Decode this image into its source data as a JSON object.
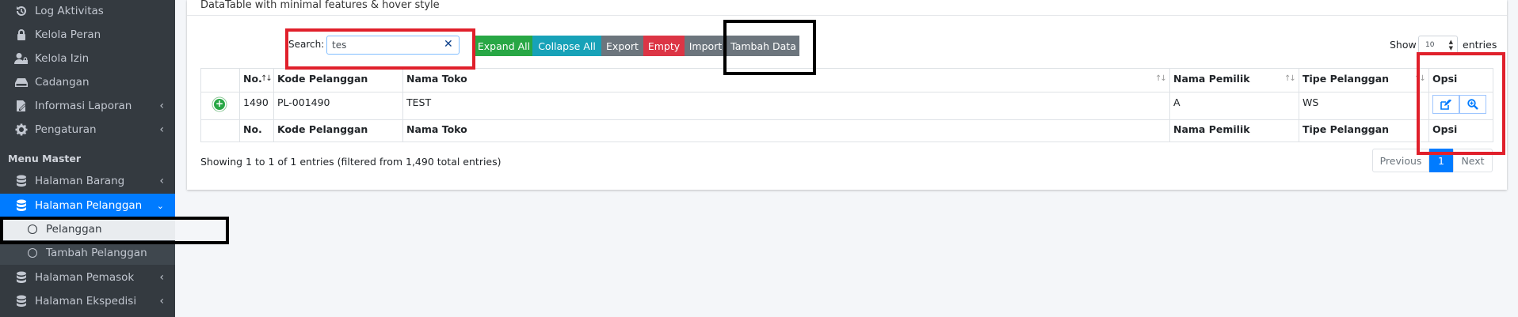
{
  "sidebar": {
    "items": [
      {
        "label": "Log Aktivitas",
        "icon": "history-icon"
      },
      {
        "label": "Kelola Peran",
        "icon": "lock-icon"
      },
      {
        "label": "Kelola Izin",
        "icon": "user-lock-icon"
      },
      {
        "label": "Cadangan",
        "icon": "hdd-icon"
      },
      {
        "label": "Informasi Laporan",
        "icon": "report-icon"
      },
      {
        "label": "Pengaturan",
        "icon": "gear-icon"
      }
    ],
    "header": "Menu Master",
    "master": [
      {
        "label": "Halaman Barang",
        "icon": "database-icon"
      },
      {
        "label": "Halaman Pelanggan",
        "icon": "database-icon"
      },
      {
        "label": "Pelanggan",
        "icon": "circle-icon"
      },
      {
        "label": "Tambah Pelanggan",
        "icon": "circle-icon"
      },
      {
        "label": "Halaman Pemasok",
        "icon": "database-icon"
      },
      {
        "label": "Halaman Ekspedisi",
        "icon": "database-icon"
      }
    ]
  },
  "card": {
    "title": "DataTable with minimal features & hover style"
  },
  "toolbar": {
    "search_label": "Search:",
    "search_value": "tes",
    "buttons": {
      "expand": "Expand All",
      "collapse": "Collapse All",
      "export": "Export",
      "empty": "Empty",
      "import": "Import",
      "add": "Tambah Data"
    },
    "show_label": "Show",
    "page_size": "10",
    "entries_label": "entries"
  },
  "table": {
    "headers": {
      "no": "No.",
      "kode": "Kode Pelanggan",
      "nama_toko": "Nama Toko",
      "nama_pemilik": "Nama Pemilik",
      "tipe": "Tipe Pelanggan",
      "opsi": "Opsi"
    },
    "row": {
      "no": "1490",
      "kode": "PL-001490",
      "nama_toko": "TEST",
      "nama_pemilik": "A",
      "tipe": "WS"
    }
  },
  "footer": {
    "info": "Showing 1 to 1 of 1 entries (filtered from 1,490 total entries)",
    "previous": "Previous",
    "page": "1",
    "next": "Next"
  },
  "colors": {
    "sidebar": "#343a40",
    "primary": "#007bff",
    "success": "#28a745",
    "info": "#17a2b8",
    "secondary": "#6c757d",
    "danger": "#dc3545",
    "annotation_red": "#e0202b",
    "annotation_black": "#000000"
  }
}
